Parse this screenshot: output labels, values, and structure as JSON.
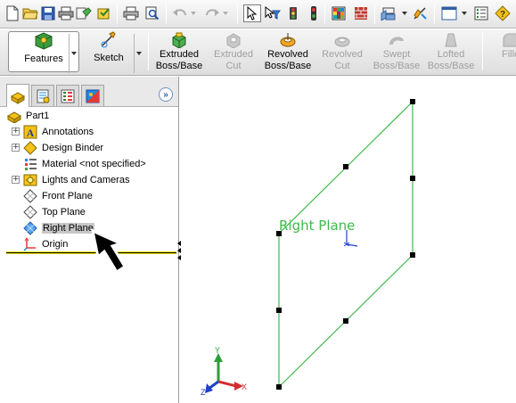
{
  "command_manager": {
    "features_tab": "Features",
    "sketch_tab": "Sketch",
    "commands": {
      "extruded_boss": [
        "Extruded",
        "Boss/Base"
      ],
      "extruded_cut": [
        "Extruded",
        "Cut"
      ],
      "revolved_boss": [
        "Revolved",
        "Boss/Base"
      ],
      "revolved_cut": [
        "Revolved",
        "Cut"
      ],
      "swept_boss": [
        "Swept",
        "Boss/Base"
      ],
      "lofted_boss": [
        "Lofted",
        "Boss/Base"
      ],
      "fillet": "Fille"
    }
  },
  "feature_tree": {
    "root": "Part1",
    "items": [
      {
        "label": "Annotations",
        "expandable": true
      },
      {
        "label": "Design Binder",
        "expandable": true
      },
      {
        "label": "Material <not specified>",
        "expandable": false
      },
      {
        "label": "Lights and Cameras",
        "expandable": true
      },
      {
        "label": "Front Plane",
        "expandable": false
      },
      {
        "label": "Top Plane",
        "expandable": false
      },
      {
        "label": "Right Plane",
        "expandable": false,
        "selected": true
      },
      {
        "label": "Origin",
        "expandable": false
      }
    ],
    "expander_symbol": "+",
    "expand_panel_symbol": "»"
  },
  "graphics": {
    "plane_label": "Right Plane",
    "triad": {
      "x": "X",
      "y": "Y",
      "z": "Z"
    }
  },
  "colors": {
    "plane": "#3fb94a",
    "selection": "#c7c7c7",
    "rollback": "#f2e600"
  }
}
